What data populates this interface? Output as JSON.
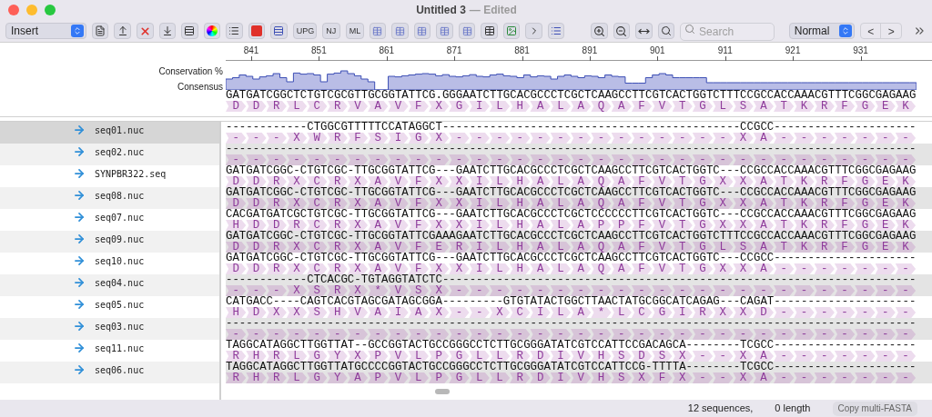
{
  "window": {
    "title": "Untitled 3",
    "subtitle": "— Edited"
  },
  "toolbar": {
    "mode_select": "Insert",
    "text_buttons": [
      "UPG",
      "NJ",
      "ML"
    ],
    "search": {
      "placeholder": "Search"
    },
    "view_select": "Normal",
    "nav_buttons": [
      "<",
      ">"
    ]
  },
  "ruler": {
    "labels": [
      "841",
      "851",
      "861",
      "871",
      "881",
      "891",
      "901",
      "911",
      "921",
      "931"
    ]
  },
  "header": {
    "conservation_label": "Conservation %",
    "consensus_label": "Consensus",
    "consensus": "GATGATCGGCTCTGTCGCGTTGCGGTATTCG.GGGAATCTTGCACGCCCTCGCTCAAGCCTTCGTCACTGGTCTTTCCGCCACCAAACGTTTCGGCGAGAAG",
    "consensus_translation": "D D R L C R V A V F X G I L H A L A Q A F V T G L S A T K R F G E K"
  },
  "sequences": [
    {
      "name": "seq01.nuc",
      "selected": true,
      "bases": "------------CTGGCGTTTTTCCATAGGCT--------------------------------------------CCGCC---------------------",
      "translation": "- - - X W R F S I G X - - - - - - - - - - - - - - X A - - - - - - -"
    },
    {
      "name": "seq02.nuc",
      "selected": false,
      "bases": "------------------------------------------------------------------------------------------------------",
      "translation": "- - - - - - - - - - - - - - - - - - - - - - - - - - - - - - - - - -"
    },
    {
      "name": "SYNPBR322.seq",
      "selected": false,
      "bases": "GATGATCGGC-CTGTCGC-TTGCGGTATTCG---GAATCTTGCACGCCCTCGCTCAAGCCTTCGTCACTGGTC---CCGCCACCAAACGTTTCGGCGAGAAG",
      "translation": "D D R X C R X A V F X X I L H A L A Q A F V T G X X A T K R F G E K"
    },
    {
      "name": "seq08.nuc",
      "selected": false,
      "bases": "GATGATCGGC-CTGTCGC-TTGCGGTATTCG---GAATCTTGCACGCCCTCGCTCAAGCCTTCGTCACTGGTC---CCGCCACCAAACGTTTCGGCGAGAAG",
      "translation": "D D R X C R X A V F X X I L H A L A Q A F V T G X X A T K R F G E K"
    },
    {
      "name": "seq07.nuc",
      "selected": false,
      "bases": "CACGATGATCGCTGTCGC-TTGCGGTATTCG---GAATCTTGCACGCCCTCGCTCCCCCCTTCGTCACTGGTC---CCGCCACCAAACGTTTCGGCGAGAAG",
      "translation": "H D D R C R X A V F X X I L H A L A P P F V T G X X A T K R F G E K"
    },
    {
      "name": "seq09.nuc",
      "selected": false,
      "bases": "GATGATCGGC-CTGTCGC-TTGCGGTATTCGAAAGAATCTTGCACGCCCTCGCTCAAGCCTTCGTCACTGGTCTTTCCGCCACCAAACGTTTCGGCGAGAAG",
      "translation": "D D R X C R X A V F E R I L H A L A Q A F V T G L S A T K R F G E K"
    },
    {
      "name": "seq10.nuc",
      "selected": false,
      "bases": "GATGATCGGC-CTGTCGC-TTGCGGTATTCG---GAATCTTGCACGCCCTCGCTCAAGCCTTCGTCACTGGTC---CCGCC---------------------",
      "translation": "D D R X C R X A V F X X I L H A L A Q A F V T G X X A - - - - - - -"
    },
    {
      "name": "seq04.nuc",
      "selected": false,
      "bases": "------------CTCACGC-TGTAGGTATCTC----------------------------------------------------------------------",
      "translation": "- - - X S R X * V S X - - - - - - - - - - - - - - - - - - - - - - -"
    },
    {
      "name": "seq05.nuc",
      "selected": false,
      "bases": "CATGACC----CAGTCACGTAGCGATAGCGGA---------GTGTATACTGGCTTAACTATGCGGCATCAGAG---CAGAT---------------------",
      "translation": "H D X X S H V A I A X - - X C I L A * L C G I R X X D - - - - - - -"
    },
    {
      "name": "seq03.nuc",
      "selected": false,
      "bases": "------------------------------------------------------------------------------------------------------",
      "translation": "- - - - - - - - - - - - - - - - - - - - - - - - - - - - - - - - - -"
    },
    {
      "name": "seq11.nuc",
      "selected": false,
      "bases": "TAGGCATAGGCTTGGTTAT--GCCGGTACTGCCGGGCCTCTTGCGGGATATCGTCCATTCCGACAGCA--------TCGCC---------------------",
      "translation": "R H R L G Y X P V L P G L L R D I V H S D S X - - X A - - - - - - -"
    },
    {
      "name": "seq06.nuc",
      "selected": false,
      "bases": "TAGGCATAGGCTTGGTTATGCCCCGGTACTGCCGGGCCTCTTGCGGGATATCGTCCATTCCG-TTTTA--------TCGCC---------------------",
      "translation": "R H R L G Y A P V L P G L L R D I V H S X F X - - X A - - - - - - -"
    }
  ],
  "status_bar": {
    "count": "12 sequences,",
    "length": "0 length",
    "copy_button": "Copy multi-FASTA"
  }
}
